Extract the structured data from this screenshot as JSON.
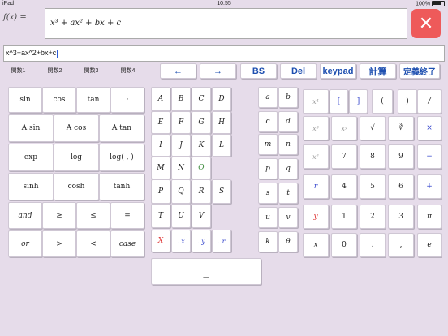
{
  "status": {
    "left": "iPad",
    "time": "10:55",
    "battery": "100%"
  },
  "formula": {
    "label": "f(x) =",
    "text": "x³ + ax² + bx + c"
  },
  "close": "✕",
  "input": {
    "value": "x^3+ax^2+bx+c"
  },
  "tabs": [
    "関数1",
    "関数2",
    "関数3",
    "関数4"
  ],
  "nav": {
    "left": "←",
    "right": "→",
    "bs": "BS",
    "del": "Del",
    "keypad": "keypad",
    "calc": "計算",
    "end": "定義終了"
  },
  "func_keys": [
    [
      "sin",
      "cos",
      "tan",
      "·"
    ],
    [
      "A sin",
      "A cos",
      "A tan"
    ],
    [
      "exp",
      "log",
      "log( , )"
    ],
    [
      "sinh",
      "cosh",
      "tanh"
    ],
    [
      "and",
      "≥",
      "≤",
      "="
    ],
    [
      "or",
      ">",
      "<",
      "case"
    ]
  ],
  "upper": [
    [
      "A",
      "B",
      "C",
      "D"
    ],
    [
      "E",
      "F",
      "G",
      "H"
    ],
    [
      "I",
      "J",
      "K",
      "L"
    ],
    [
      "M",
      "N",
      "O"
    ],
    [
      "P",
      "Q",
      "R",
      "S"
    ],
    [
      "T",
      "U",
      "V"
    ],
    [
      "X",
      ". x",
      ". y",
      ". r"
    ]
  ],
  "lower": [
    [
      "a",
      "b"
    ],
    [
      "c",
      "d"
    ],
    [
      "m",
      "n"
    ],
    [
      "p",
      "q"
    ],
    [
      "s",
      "t"
    ],
    [
      "u",
      "v"
    ],
    [
      "k",
      "θ"
    ]
  ],
  "keypad": [
    [
      "x⁴",
      "[",
      "]",
      "(",
      ")",
      "/"
    ],
    [
      "x³",
      "xʸ",
      "√",
      "∛",
      "×"
    ],
    [
      "x²",
      "7",
      "8",
      "9",
      "−"
    ],
    [
      "r",
      "4",
      "5",
      "6",
      "+"
    ],
    [
      "y",
      "1",
      "2",
      "3",
      "π"
    ],
    [
      "x",
      "0",
      ".",
      ",",
      "e"
    ]
  ],
  "underscore": "_"
}
